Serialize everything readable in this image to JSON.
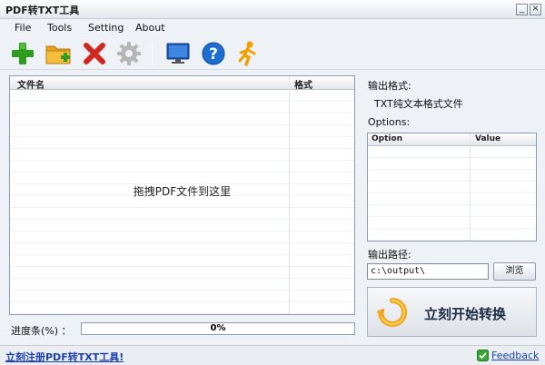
{
  "window": {
    "title": "PDF转TXT工具",
    "minimize_glyph": "_",
    "close_glyph": "×"
  },
  "menu": {
    "items": [
      "File",
      "Tools",
      "Setting",
      "About"
    ]
  },
  "toolbar": {
    "buttons": [
      {
        "icon": "plus-icon",
        "color": "#2e9c1e"
      },
      {
        "icon": "folder-add-icon",
        "color": "#e8a21a"
      },
      {
        "icon": "delete-x-icon",
        "color": "#d0281e"
      },
      {
        "icon": "gear-icon",
        "color": "#b5b5b5"
      },
      {
        "icon": "monitor-icon",
        "color": "#1c5ab8"
      },
      {
        "icon": "help-icon",
        "color": "#1c6fd0"
      },
      {
        "icon": "runner-icon",
        "color": "#f0a000"
      }
    ]
  },
  "file_list": {
    "columns": [
      "文件名",
      "格式"
    ],
    "rows": [],
    "drop_hint": "拖拽PDF文件到这里"
  },
  "progress": {
    "label": "进度条(%) ：",
    "value": 0,
    "text": "0%"
  },
  "output_format": {
    "label": "输出格式:",
    "value": "TXT纯文本格式文件"
  },
  "options": {
    "label": "Options:",
    "columns": [
      "Option",
      "Value"
    ],
    "rows": []
  },
  "output_path": {
    "label": "输出路径:",
    "value": "c:\\output\\",
    "browse_label": "浏览"
  },
  "convert": {
    "label": "立刻开始转换",
    "icon": "refresh-arrow-icon",
    "color": "#f2a51c"
  },
  "statusbar": {
    "register_link": "立刻注册PDF转TXT工具!",
    "feedback_label": "Feedback",
    "feedback_icon": "check-icon"
  },
  "colors": {
    "accent": "#1a3fb0",
    "progress_fill": "#5b9be0"
  }
}
